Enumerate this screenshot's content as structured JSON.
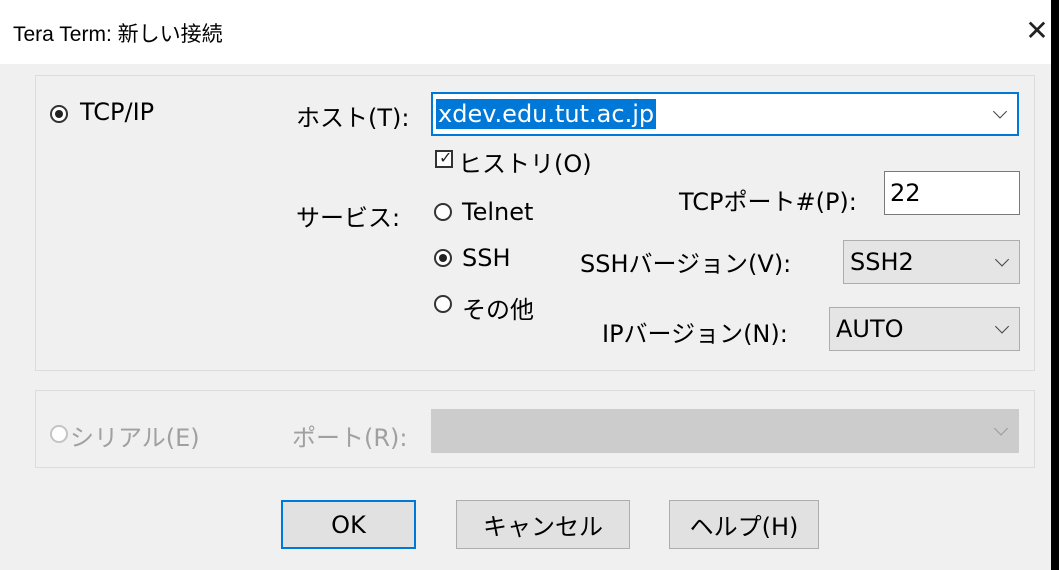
{
  "window": {
    "title": "Tera Term: 新しい接続"
  },
  "tcpip": {
    "radio_label": "TCP/IP",
    "host_label": "ホスト(T):",
    "host_value": "xdev.edu.tut.ac.jp",
    "history_label": "ヒストリ(O)",
    "history_checked": true,
    "service_label": "サービス:",
    "service_options": [
      "Telnet",
      "SSH",
      "その他"
    ],
    "service_selected": "SSH",
    "tcp_port_label": "TCPポート#(P):",
    "tcp_port_value": "22",
    "ssh_version_label": "SSHバージョン(V):",
    "ssh_version_value": "SSH2",
    "ip_version_label": "IPバージョン(N):",
    "ip_version_value": "AUTO"
  },
  "serial": {
    "radio_label": "シリアル(E)",
    "port_label": "ポート(R):",
    "port_value": ""
  },
  "buttons": {
    "ok": "OK",
    "cancel": "キャンセル",
    "help": "ヘルプ(H)"
  },
  "colors": {
    "accent": "#0078d7",
    "disabled_text": "#a0a0a0"
  }
}
